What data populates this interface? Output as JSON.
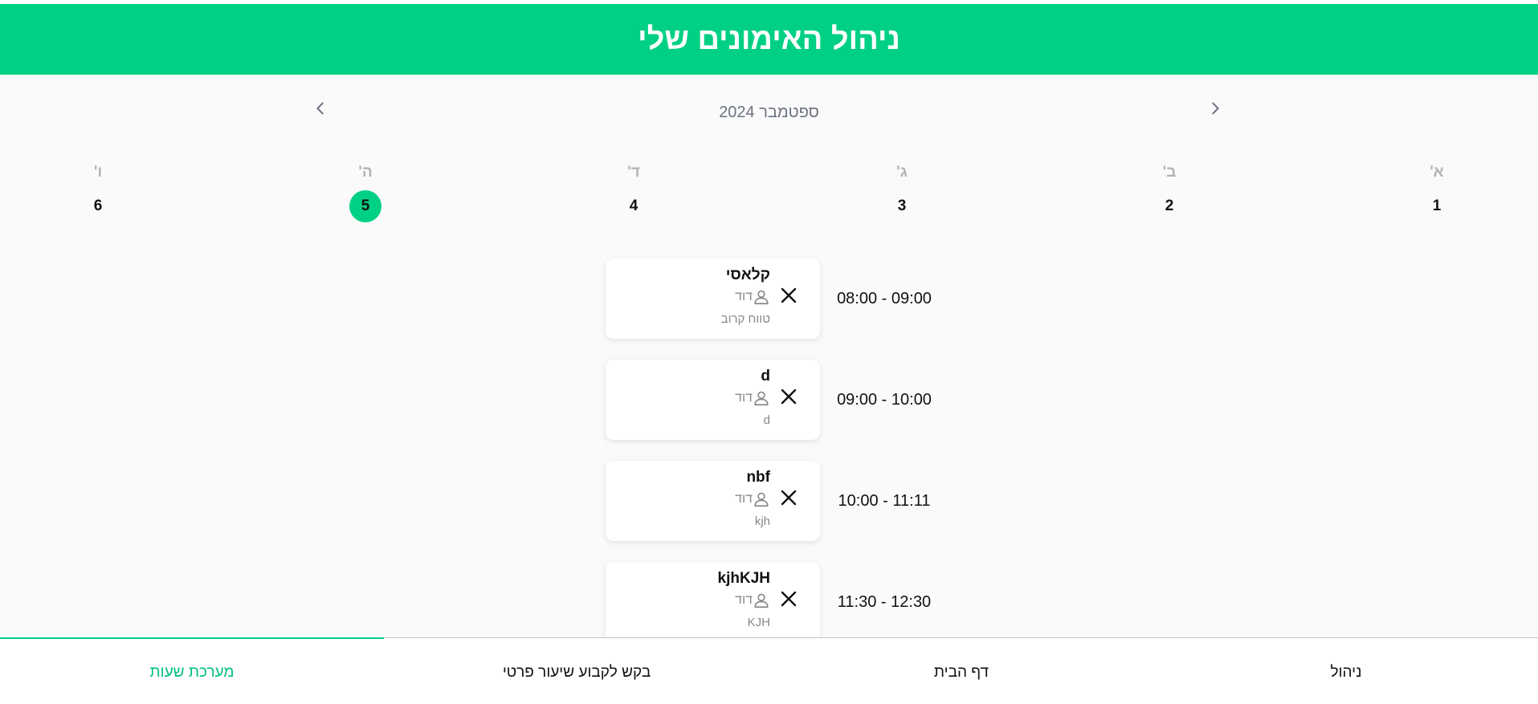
{
  "header": {
    "title": "ניהול האימונים שלי"
  },
  "calendar": {
    "month_label": "ספטמבר 2024",
    "days": [
      {
        "name": "א'",
        "number": "1"
      },
      {
        "name": "ב'",
        "number": "2"
      },
      {
        "name": "ג'",
        "number": "3"
      },
      {
        "name": "ד'",
        "number": "4"
      },
      {
        "name": "ה'",
        "number": "5",
        "selected": true
      },
      {
        "name": "ו'",
        "number": "6"
      }
    ]
  },
  "sessions": [
    {
      "time": "08:00 - 09:00",
      "title": "קלאסי",
      "trainer": "דוד",
      "subtitle": "טווח קרוב"
    },
    {
      "time": "09:00 - 10:00",
      "title": "d",
      "trainer": "דוד",
      "subtitle": "d"
    },
    {
      "time": "10:00 - 11:11",
      "title": "nbf",
      "trainer": "דוד",
      "subtitle": "kjh"
    },
    {
      "time": "11:30 - 12:30",
      "title": "kjhKJH",
      "trainer": "דוד",
      "subtitle": "KJH"
    }
  ],
  "bottom_nav": {
    "items": [
      {
        "label": "ניהול"
      },
      {
        "label": "דף הבית"
      },
      {
        "label": "בקש לקבוע שיעור פרטי"
      },
      {
        "label": "מערכת שעות",
        "active": true
      }
    ]
  },
  "icons": {
    "prev": "chevron-left-icon",
    "next": "chevron-right-icon",
    "remove": "close-icon",
    "trainer": "person-icon"
  },
  "colors": {
    "accent": "#00d084",
    "accent_text": "#00c07a",
    "background": "#fafafa",
    "muted_text": "#888888"
  }
}
